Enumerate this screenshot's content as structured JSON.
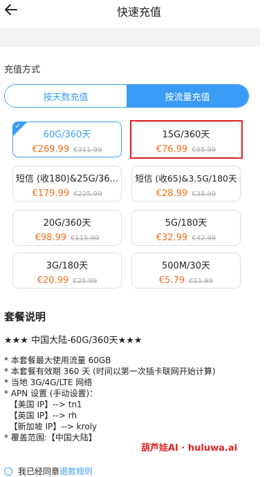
{
  "header": {
    "title": "快速充值"
  },
  "recharge": {
    "section_label": "充值方式",
    "tabs": [
      "按天数充值",
      "按流量充值"
    ]
  },
  "plans": [
    {
      "name": "60G/360天",
      "price": "€269.99",
      "old_price": "€311.99",
      "selected": true
    },
    {
      "name": "15G/360天",
      "price": "€76.99",
      "old_price": "€95.99",
      "selected": false
    },
    {
      "name": "短信 (收180)&25G/36...",
      "price": "€179.99",
      "old_price": "€225.99",
      "selected": false
    },
    {
      "name": "短信 (收65)&3.5G/180天",
      "price": "€28.99",
      "old_price": "€38.99",
      "selected": false
    },
    {
      "name": "20G/360天",
      "price": "€98.99",
      "old_price": "€115.99",
      "selected": false
    },
    {
      "name": "5G/180天",
      "price": "€32.99",
      "old_price": "€42.99",
      "selected": false
    },
    {
      "name": "3G/180天",
      "price": "€20.99",
      "old_price": "€25.99",
      "selected": false
    },
    {
      "name": "500M/30天",
      "price": "€5.79",
      "old_price": "€11.99",
      "selected": false
    }
  ],
  "description": {
    "title": "套餐说明",
    "subtitle": "★★★ 中国大陆-60G/360天★★★",
    "lines": [
      "* 本套餐最大使用流量 60GB",
      "* 本套餐有效期 360 天 (时间以第一次插卡联网开始计算)",
      "* 当地 3G/4G/LTE 网络",
      "* APN 设置 (手动设置)：",
      "  【美国 IP】--> tn1",
      "  【英国 IP】--> rh",
      "  【新加坡 IP】--> kroly",
      "* 覆盖范围:【中国大陆】"
    ]
  },
  "watermark": "葫芦娃AI · huluwa.ai",
  "agreement": {
    "text": "我已经同意",
    "link": "退款规则"
  },
  "colors": {
    "accent": "#3a9cf4",
    "price": "#ef6e1e",
    "highlight": "#e02020"
  }
}
